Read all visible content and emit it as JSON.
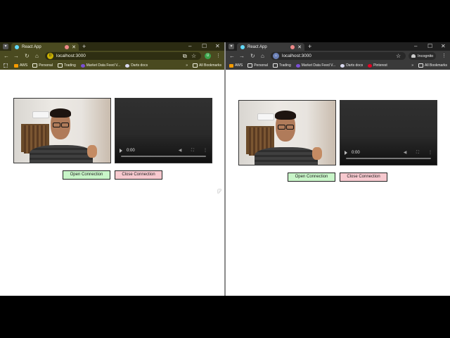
{
  "windows": [
    {
      "id": "left",
      "tab": {
        "title": "React App",
        "new_tab": "+"
      },
      "window_controls": {
        "minimize": "–",
        "maximize": "☐",
        "close": "✕"
      },
      "address": {
        "url": "localhost:3000",
        "badge": "D"
      },
      "profile_initial": "U",
      "bookmarks": [
        {
          "icon": "aws-icon",
          "label": "AWS"
        },
        {
          "icon": "folder-icon",
          "label": "Personal"
        },
        {
          "icon": "folder-icon",
          "label": "Trading"
        },
        {
          "icon": "market-data-icon",
          "label": "Market Data Feed V..."
        },
        {
          "icon": "darts-icon",
          "label": "Darts docs"
        }
      ],
      "bookmarks_overflow": "»",
      "all_bookmarks": "All Bookmarks",
      "video": {
        "time": "0:00"
      },
      "buttons": {
        "open": "Open Connection",
        "close": "Close Connection"
      }
    },
    {
      "id": "right",
      "tab": {
        "title": "React App",
        "new_tab": "+"
      },
      "window_controls": {
        "minimize": "–",
        "maximize": "☐",
        "close": "✕"
      },
      "address": {
        "url": "localhost:3000",
        "badge": "⌂"
      },
      "incognito_label": "Incognito",
      "bookmarks": [
        {
          "icon": "aws-icon",
          "label": "AWS"
        },
        {
          "icon": "folder-icon",
          "label": "Personal"
        },
        {
          "icon": "folder-icon",
          "label": "Trading"
        },
        {
          "icon": "market-data-icon",
          "label": "Market Data Feed V..."
        },
        {
          "icon": "darts-icon",
          "label": "Darts docs"
        },
        {
          "icon": "pinterest-icon",
          "label": "Pinterest"
        }
      ],
      "bookmarks_overflow": "»",
      "all_bookmarks": "All Bookmarks",
      "video": {
        "time": "0:00"
      },
      "buttons": {
        "open": "Open Connection",
        "close": "Close Connection"
      }
    }
  ],
  "colors": {
    "open_button": "#c8f5c8",
    "close_button": "#f7c9cf",
    "left_theme": "#4a4a20",
    "incognito_theme": "#3a3a3a"
  }
}
